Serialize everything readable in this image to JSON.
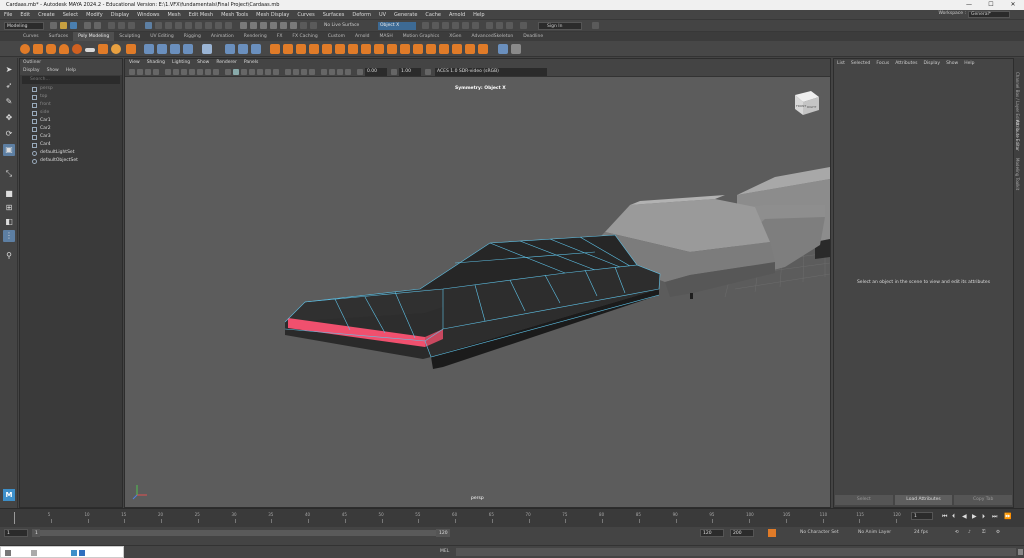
{
  "window": {
    "title": "Cardaas.mb* - Autodesk MAYA 2024.2 - Educational Version: E:\\1.VFX\\fundamentals\\Final Project\\Cardaas.mb",
    "minimize": "—",
    "maximize": "☐",
    "close": "✕"
  },
  "menubar": {
    "items": [
      "File",
      "Edit",
      "Create",
      "Select",
      "Modify",
      "Display",
      "Windows",
      "Mesh",
      "Edit Mesh",
      "Mesh Tools",
      "Mesh Display",
      "Curves",
      "Surfaces",
      "Deform",
      "UV",
      "Generate",
      "Cache",
      "Arnold",
      "Help"
    ],
    "workspace_label": "Workspace :",
    "workspace_value": "General*"
  },
  "statusline": {
    "mode": "Modeling",
    "live_surface": "No Live Surface",
    "object_field": "Object X",
    "sign_in": "Sign In"
  },
  "shelf": {
    "tabs": [
      "Curves",
      "Surfaces",
      "Poly Modeling",
      "Sculpting",
      "UV Editing",
      "Rigging",
      "Animation",
      "Rendering",
      "FX",
      "FX Caching",
      "Custom",
      "Arnold",
      "MASH",
      "Motion Graphics",
      "XGen",
      "AdvancedSkeleton",
      "Deadline"
    ],
    "active_tab": "Poly Modeling"
  },
  "outliner": {
    "title": "Outliner",
    "menu": [
      "Display",
      "Show",
      "Help"
    ],
    "search_placeholder": "Search...",
    "items": [
      {
        "label": "persp",
        "dim": true
      },
      {
        "label": "top",
        "dim": true
      },
      {
        "label": "front",
        "dim": true
      },
      {
        "label": "side",
        "dim": true
      },
      {
        "label": "Car1",
        "dim": false
      },
      {
        "label": "Car2",
        "dim": false
      },
      {
        "label": "Car3",
        "dim": false
      },
      {
        "label": "Car4",
        "dim": false
      },
      {
        "label": "defaultLightSet",
        "dim": false
      },
      {
        "label": "defaultObjectSet",
        "dim": false
      }
    ]
  },
  "viewport": {
    "menu": [
      "View",
      "Shading",
      "Lighting",
      "Show",
      "Renderer",
      "Panels"
    ],
    "field_a": "0.00",
    "field_b": "1.00",
    "colorspace": "ACES 1.0 SDR-video (sRGB)",
    "symmetry_label": "Symmetry: Object X",
    "camera_label": "persp",
    "viewcube_label": "FRONT",
    "viewcube_side": "RIGHT",
    "accent": "#f0506e",
    "wire_color": "#5fc3e8"
  },
  "attribute_editor": {
    "menu": [
      "List",
      "Selected",
      "Focus",
      "Attributes",
      "Display",
      "Show",
      "Help"
    ],
    "message": "Select an object in the scene to view and edit its attributes",
    "buttons": [
      "Select",
      "Load Attributes",
      "Copy Tab"
    ]
  },
  "side_tabs": [
    "Channel Box / Layer Editor",
    "Attribute Editor",
    "Modeling Toolkit"
  ],
  "timeslider": {
    "ticks": [
      "5",
      "10",
      "15",
      "20",
      "25",
      "30",
      "35",
      "40",
      "45",
      "50",
      "55",
      "60",
      "65",
      "70",
      "75",
      "80",
      "85",
      "90",
      "95",
      "100",
      "105",
      "110",
      "115",
      "120"
    ],
    "current_frame": "1"
  },
  "rangeslider": {
    "start": "1",
    "inner_start": "1",
    "inner_end": "120",
    "range_end": "120",
    "end": "200",
    "character_set": "No Character Set",
    "anim_layer": "No Anim Layer",
    "fps": "24 fps"
  },
  "cmdline": {
    "mode": "MEL"
  }
}
